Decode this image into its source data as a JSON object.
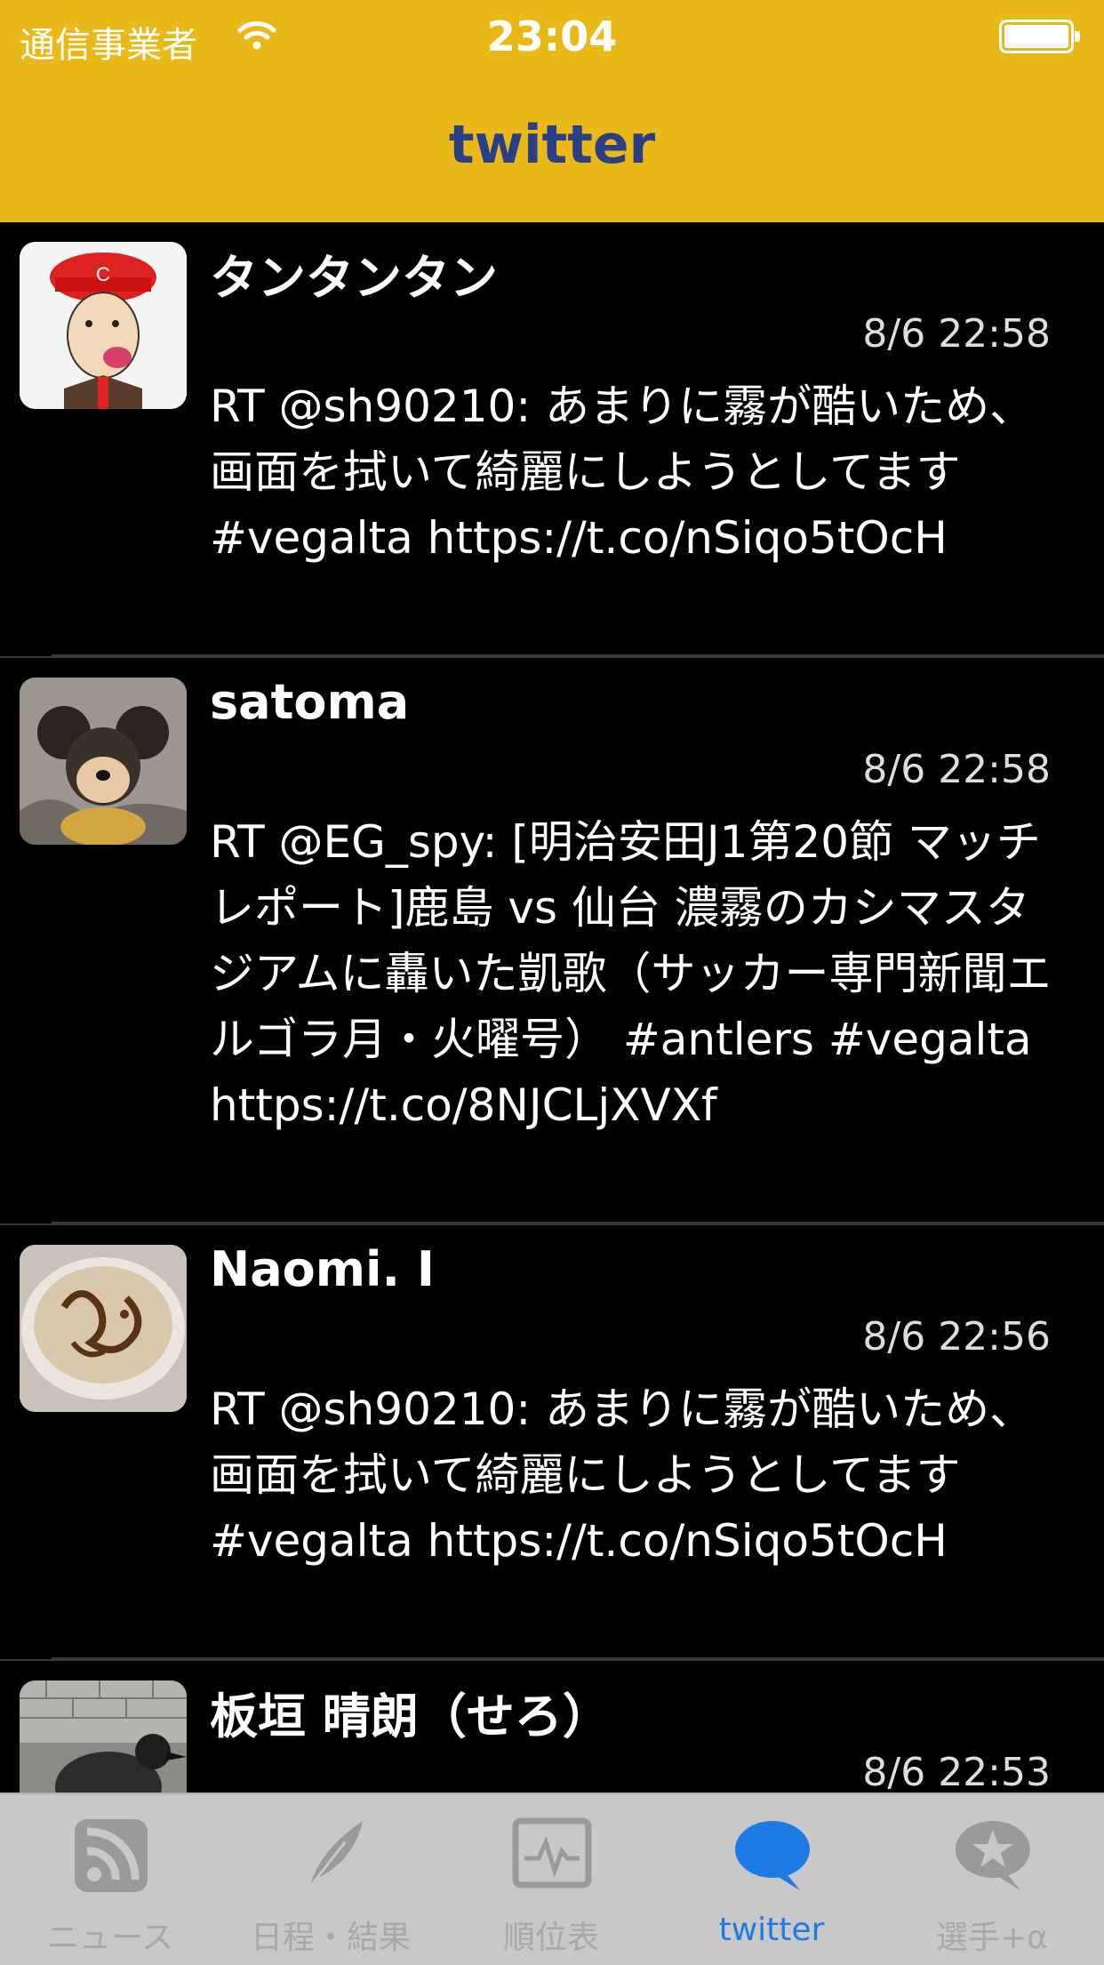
{
  "status_bar": {
    "carrier": "通信事業者",
    "time": "23:04"
  },
  "nav": {
    "title": "twitter"
  },
  "tweets": [
    {
      "user": "タンタンタン",
      "time": "8/6 22:58",
      "text": "RT @sh90210: あまりに霧が酷いため、画面を拭いて綺麗にしようとしてます #vegalta https://t.co/nSiqo5tOcH",
      "avatar": "cartoon-face-red-cap"
    },
    {
      "user": "satoma",
      "time": "8/6 22:58",
      "text": "RT @EG_spy: [明治安田J1第20節 マッチレポート]鹿島 vs 仙台 濃霧のカシマスタジアムに轟いた凱歌（サッカー専門新聞エルゴラ月・火曜号） #antlers #vegalta https://t.co/8NJCLjXVXf",
      "avatar": "mouse-figure-photo"
    },
    {
      "user": "Naomi. I",
      "time": "8/6 22:56",
      "text": "RT @sh90210: あまりに霧が酷いため、画面を拭いて綺麗にしようとしてます #vegalta https://t.co/nSiqo5tOcH",
      "avatar": "latte-art-photo"
    },
    {
      "user": "板垣 晴朗（せろ）",
      "time": "8/6 22:53",
      "text": "",
      "avatar": "crow-photo"
    }
  ],
  "tabs": [
    {
      "label": "ニュース",
      "icon": "rss-icon",
      "active": false
    },
    {
      "label": "日程・結果",
      "icon": "feather-icon",
      "active": false
    },
    {
      "label": "順位表",
      "icon": "chart-monitor-icon",
      "active": false
    },
    {
      "label": "twitter",
      "icon": "speech-bubble-icon",
      "active": true
    },
    {
      "label": "選手+α",
      "icon": "star-bubble-icon",
      "active": false
    }
  ],
  "colors": {
    "nav_background": "#E8B918",
    "nav_title": "#2A3F86",
    "feed_background": "#000000",
    "tab_active": "#1E7BE6",
    "tab_inactive": "#A8A8A8"
  }
}
